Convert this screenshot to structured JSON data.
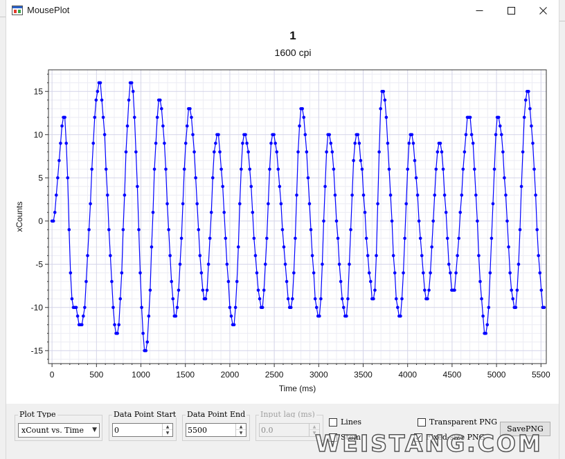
{
  "window": {
    "title": "MousePlot",
    "minimize_icon": "minimize-icon",
    "maximize_icon": "maximize-icon",
    "close_icon": "close-icon"
  },
  "plot": {
    "title": "1",
    "subtitle": "1600 cpi"
  },
  "chart_data": {
    "type": "line",
    "title": "1",
    "subtitle": "1600 cpi",
    "xlabel": "Time (ms)",
    "ylabel": "xCounts",
    "xlim": [
      -40,
      5560
    ],
    "ylim": [
      -16.5,
      17.5
    ],
    "x_ticks": [
      0,
      500,
      1000,
      1500,
      2000,
      2500,
      3000,
      3500,
      4000,
      4500,
      5000,
      5500
    ],
    "y_ticks": [
      -15,
      -10,
      -5,
      0,
      5,
      10,
      15
    ],
    "grid": true,
    "line_color": "#0000ff",
    "marker_color": "#0000ff",
    "series": [
      {
        "style": "markers+smoothed-line",
        "peaks": [
          [
            0,
            0
          ],
          [
            140,
            12
          ],
          [
            230,
            -9.5
          ],
          [
            330,
            -12
          ],
          [
            530,
            16
          ],
          [
            730,
            -13
          ],
          [
            890,
            16
          ],
          [
            1050,
            -15
          ],
          [
            1210,
            14
          ],
          [
            1390,
            -11
          ],
          [
            1545,
            13
          ],
          [
            1720,
            -9
          ],
          [
            1855,
            10
          ],
          [
            2040,
            -12
          ],
          [
            2165,
            10
          ],
          [
            2360,
            -10
          ],
          [
            2485,
            10
          ],
          [
            2690,
            -10
          ],
          [
            2805,
            13
          ],
          [
            3000,
            -11
          ],
          [
            3110,
            10
          ],
          [
            3300,
            -11
          ],
          [
            3425,
            10
          ],
          [
            3620,
            -9
          ],
          [
            3715,
            15
          ],
          [
            3910,
            -11
          ],
          [
            4035,
            10
          ],
          [
            4220,
            -9
          ],
          [
            4355,
            9
          ],
          [
            4510,
            -8
          ],
          [
            4690,
            12
          ],
          [
            4880,
            -13
          ],
          [
            5020,
            12
          ],
          [
            5205,
            -10
          ],
          [
            5345,
            15
          ],
          [
            5535,
            -10
          ],
          [
            5560,
            -12
          ]
        ],
        "sample_interval_ms": 16
      }
    ]
  },
  "controls": {
    "plot_type": {
      "label": "Plot Type",
      "value": "xCount vs. Time"
    },
    "data_point_start": {
      "label": "Data Point Start",
      "value": "0"
    },
    "data_point_end": {
      "label": "Data Point End",
      "value": "5500"
    },
    "input_lag": {
      "label": "Input lag (ms)",
      "value": "0.0"
    },
    "lines": {
      "label": "Lines",
      "checked": false
    },
    "stem": {
      "label": "Stem",
      "checked": false
    },
    "transparent_png": {
      "label": "Transparent PNG",
      "checked": false
    },
    "fixed_size_png": {
      "label": "Fixed-size PNG",
      "checked": true
    },
    "save_png": {
      "label": "SavePNG"
    }
  },
  "watermark": {
    "text": "WEISTANG.COM"
  },
  "colors": {
    "series": "#0000ff",
    "grid_major": "#d4d4e8",
    "grid_minor": "#ececf4",
    "panel": "#f0f0f0"
  }
}
